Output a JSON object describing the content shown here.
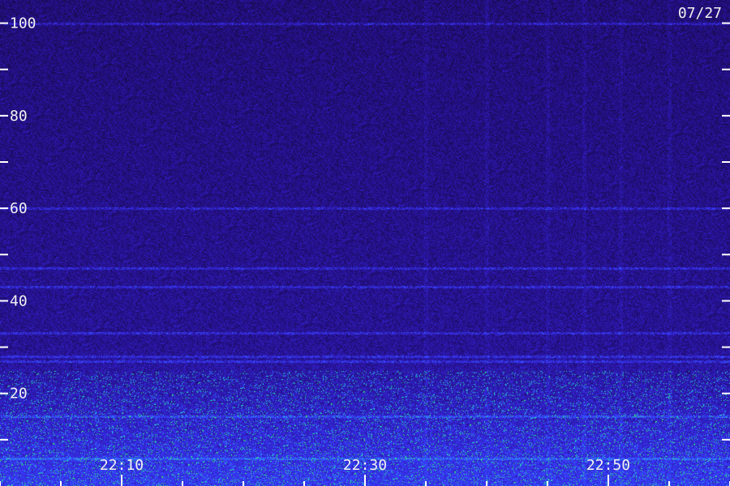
{
  "chart_data": {
    "type": "heatmap",
    "title": "",
    "date_label": "07/27",
    "ylim": [
      0,
      105
    ],
    "y_tick_labels": [
      {
        "value": 100,
        "text": "100"
      },
      {
        "value": 80,
        "text": "80"
      },
      {
        "value": 60,
        "text": "60"
      },
      {
        "value": 40,
        "text": "40"
      },
      {
        "value": 20,
        "text": "20"
      }
    ],
    "y_minor_ticks": [
      10,
      30,
      50,
      70,
      90
    ],
    "x_range_minutes": [
      "22:00",
      "23:00"
    ],
    "x_tick_labels": [
      {
        "time": "22:10",
        "text": "22:10"
      },
      {
        "time": "22:30",
        "text": "22:30"
      },
      {
        "time": "22:50",
        "text": "22:50"
      }
    ],
    "colormap": [
      "#140a3c",
      "#2a12a0",
      "#3a3aff",
      "#2a8cff",
      "#20e0c0",
      "#40ff60"
    ],
    "background_color": "#1a0f50",
    "notable_horizontal_lines": [
      100,
      60,
      47,
      43,
      33,
      28,
      27,
      15,
      6
    ],
    "notable_vertical_bands": [
      "22:35",
      "22:40",
      "22:45",
      "22:48",
      "22:51",
      "22:55"
    ],
    "grid": false,
    "legend": "none"
  }
}
